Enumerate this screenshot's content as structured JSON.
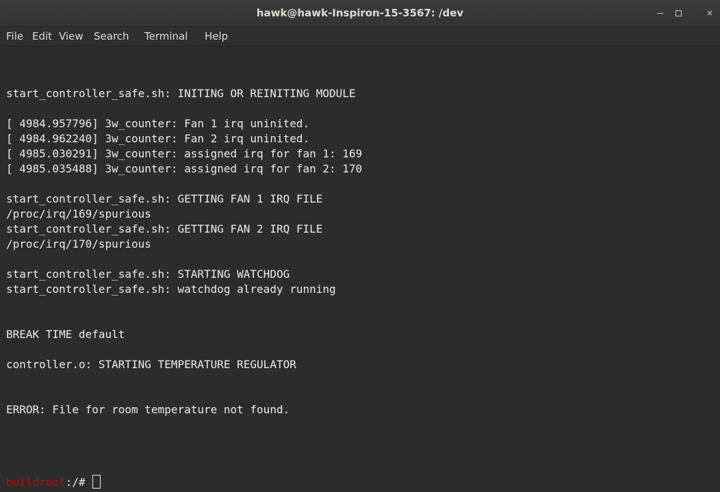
{
  "window": {
    "title": "hawk@hawk-Inspiron-15-3567: /dev",
    "close_glyph": "×"
  },
  "menu": {
    "items": [
      "File",
      "Edit",
      "View",
      "Search",
      "Terminal",
      "Help"
    ]
  },
  "terminal": {
    "output": "start_controller_safe.sh: INITING OR REINITING MODULE\n\n[ 4984.957796] 3w_counter: Fan 1 irq uninited.\n[ 4984.962240] 3w_counter: Fan 2 irq uninited.\n[ 4985.030291] 3w_counter: assigned irq for fan 1: 169\n[ 4985.035488] 3w_counter: assigned irq for fan 2: 170\n\nstart_controller_safe.sh: GETTING FAN 1 IRQ FILE\n/proc/irq/169/spurious\nstart_controller_safe.sh: GETTING FAN 2 IRQ FILE\n/proc/irq/170/spurious\n\nstart_controller_safe.sh: STARTING WATCHDOG\nstart_controller_safe.sh: watchdog already running\n\n\nBREAK TIME default\n\ncontroller.o: STARTING TEMPERATURE REGULATOR\n\n\nERROR: File for room temperature not found.",
    "prompt_host": "buildroot",
    "prompt_path": ":/# "
  },
  "colors": {
    "background": "#2c2c2c",
    "text": "#ececec",
    "prompt_host": "#cc0000"
  }
}
